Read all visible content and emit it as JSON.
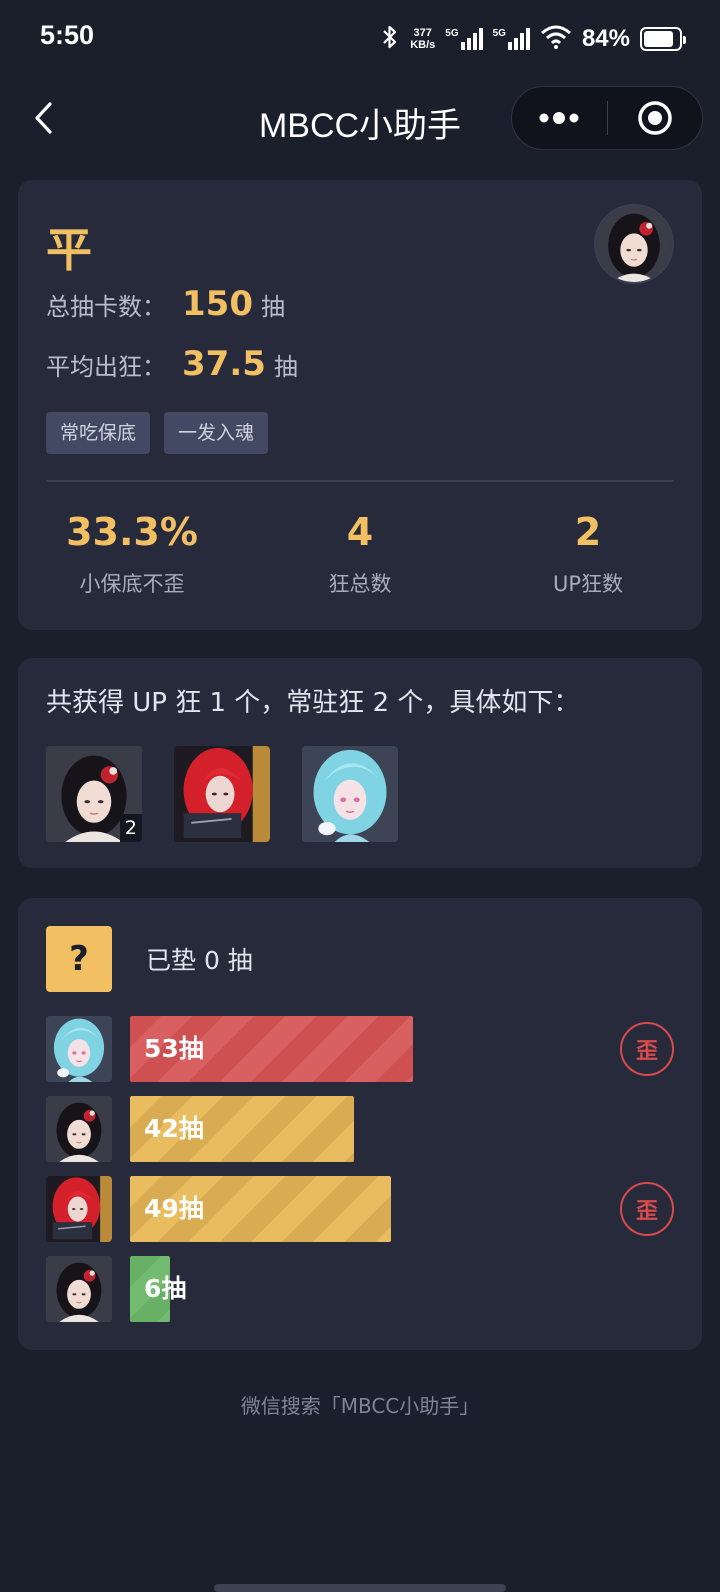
{
  "status_bar": {
    "time": "5:50",
    "speed_value": "377",
    "speed_unit": "KB/s",
    "net1": "5G",
    "net2": "5G",
    "battery_pct": "84%",
    "battery_level": 0.84
  },
  "nav": {
    "title": "MBCC小助手",
    "back_icon": "chevron-left-icon",
    "more_icon": "more-dots-icon",
    "close_icon": "target-circle-icon"
  },
  "overview": {
    "rank": "平",
    "total_label": "总抽卡数：",
    "total_value": "150",
    "total_unit": "抽",
    "avg_label": "平均出狂：",
    "avg_value": "37.5",
    "avg_unit": "抽",
    "tags": [
      "常吃保底",
      "一发入魂"
    ],
    "metrics": [
      {
        "value": "33.3%",
        "label": "小保底不歪"
      },
      {
        "value": "4",
        "label": "狂总数"
      },
      {
        "value": "2",
        "label": "UP狂数"
      }
    ]
  },
  "obtained": {
    "summary": "共获得 UP 狂 1 个，常驻狂 2 个，具体如下：",
    "items": [
      {
        "character": "dark-hair-red-flower",
        "count": "2"
      },
      {
        "character": "red-hair",
        "count": ""
      },
      {
        "character": "blue-hair",
        "count": ""
      }
    ]
  },
  "history": {
    "pending_icon": "?",
    "pending_text": "已垫 0 抽",
    "max_pulls": 90,
    "rows": [
      {
        "character": "blue-hair",
        "pulls": 53,
        "label": "53抽",
        "color": "red",
        "off_banner": true,
        "badge": "歪"
      },
      {
        "character": "dark-hair-red-flower",
        "pulls": 42,
        "label": "42抽",
        "color": "gold",
        "off_banner": false,
        "badge": ""
      },
      {
        "character": "red-hair",
        "pulls": 49,
        "label": "49抽",
        "color": "gold",
        "off_banner": true,
        "badge": "歪"
      },
      {
        "character": "dark-hair-red-flower",
        "pulls": 6,
        "label": "6抽",
        "color": "green",
        "off_banner": false,
        "badge": ""
      }
    ]
  },
  "footer": "微信搜索「MBCC小助手」",
  "colors": {
    "accent": "#f2c063",
    "danger": "#d94a4a",
    "card": "#262a3b",
    "background": "#1b1e2b"
  }
}
